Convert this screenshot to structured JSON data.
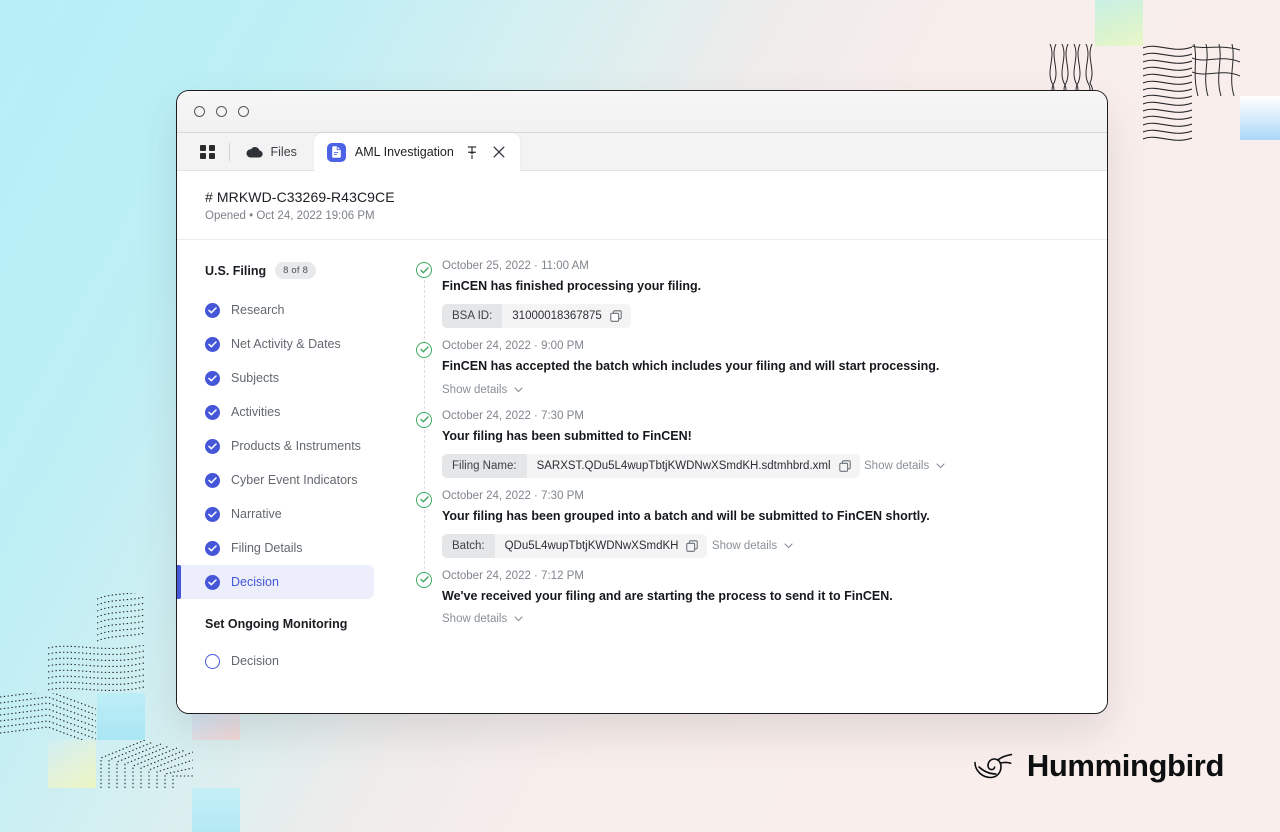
{
  "window": {
    "traffic_lights": [
      "close",
      "minimize",
      "maximize"
    ]
  },
  "tabstrip": {
    "apps_icon": "grid-icon",
    "files_tab": {
      "label": "Files",
      "icon": "cloud-icon"
    },
    "active_tab": {
      "label": "AML Investigation",
      "icon": "document-icon",
      "pin_icon": "pin-icon",
      "close_icon": "close-icon"
    }
  },
  "case_header": {
    "id": "# MRKWD-C33269-R43C9CE",
    "status": "Opened • Oct 24, 2022 19:06 PM"
  },
  "sidebar": {
    "sections": [
      {
        "title": "U.S. Filing",
        "count_badge": "8 of 8",
        "items": [
          {
            "label": "Research",
            "state": "complete",
            "active": false
          },
          {
            "label": "Net Activity & Dates",
            "state": "complete",
            "active": false
          },
          {
            "label": "Subjects",
            "state": "complete",
            "active": false
          },
          {
            "label": "Activities",
            "state": "complete",
            "active": false
          },
          {
            "label": "Products & Instruments",
            "state": "complete",
            "active": false
          },
          {
            "label": "Cyber Event Indicators",
            "state": "complete",
            "active": false
          },
          {
            "label": "Narrative",
            "state": "complete",
            "active": false
          },
          {
            "label": "Filing Details",
            "state": "complete",
            "active": false
          },
          {
            "label": "Decision",
            "state": "complete",
            "active": true
          }
        ]
      },
      {
        "title": "Set Ongoing Monitoring",
        "count_badge": "",
        "items": [
          {
            "label": "Decision",
            "state": "incomplete",
            "active": false
          }
        ]
      }
    ]
  },
  "timeline": {
    "events": [
      {
        "time": "October 25, 2022 · 11:00 AM",
        "title": "FinCEN has finished processing your filing.",
        "field": {
          "key": "BSA ID:",
          "value": "31000018367875",
          "copy": true
        },
        "show_details": ""
      },
      {
        "time": "October 24, 2022 · 9:00 PM",
        "title": "FinCEN has accepted the batch which includes your filing and will start processing.",
        "field": null,
        "show_details": "Show details"
      },
      {
        "time": "October 24, 2022 · 7:30 PM",
        "title": "Your filing has been submitted to FinCEN!",
        "field": {
          "key": "Filing Name:",
          "value": "SARXST.QDu5L4wupTbtjKWDNwXSmdKH.sdtmhbrd.xml",
          "copy": true
        },
        "show_details": "Show details"
      },
      {
        "time": "October 24, 2022 · 7:30 PM",
        "title": "Your filing has been grouped into a batch and will be submitted to FinCEN shortly.",
        "field": {
          "key": "Batch:",
          "value": "QDu5L4wupTbtjKWDNwXSmdKH",
          "copy": true
        },
        "show_details": "Show details"
      },
      {
        "time": "October 24, 2022 · 7:12 PM",
        "title": "We've received your filing and are starting the process to send it to FinCEN.",
        "field": null,
        "show_details": "Show details"
      }
    ]
  },
  "brand": {
    "name": "Hummingbird",
    "logo_icon": "hummingbird-logo-icon"
  },
  "colors": {
    "accent_blue": "#4656d8",
    "accent_blue_soft": "#eceefc",
    "success_green": "#3fa964",
    "bg_cyan": "#b6eff8",
    "bg_pink": "#faeeec",
    "tab_blue": "#4c63e6"
  }
}
